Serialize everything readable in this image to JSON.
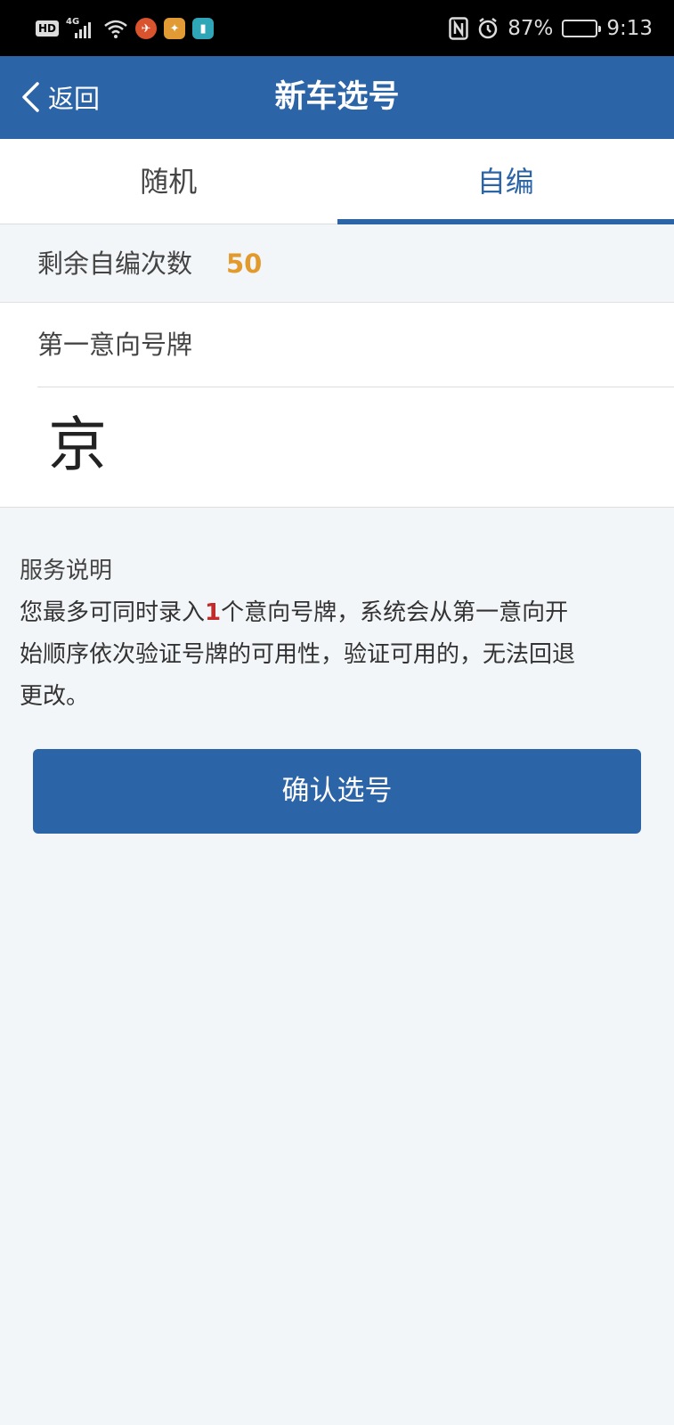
{
  "status_bar": {
    "hd": "HD",
    "network": "4G",
    "battery": "87%",
    "battery_level": 0.87,
    "time": "9:13",
    "icons": [
      "hd-icon",
      "signal-icon",
      "wifi-icon",
      "app-icon",
      "app-icon",
      "app-icon",
      "nfc-icon",
      "alarm-icon",
      "battery-icon"
    ]
  },
  "nav": {
    "back_label": "返回",
    "title": "新车选号"
  },
  "tabs": [
    {
      "label": "随机",
      "active": false
    },
    {
      "label": "自编",
      "active": true
    }
  ],
  "remaining": {
    "label": "剩余自编次数",
    "count": "50"
  },
  "preference": {
    "label": "第一意向号牌",
    "plate_prefix": "京"
  },
  "service": {
    "title": "服务说明",
    "line1_a": "您最多可同时录入",
    "line1_num": "1",
    "line1_b": "个意向号牌，系统会从第一意向开",
    "line2": "始顺序依次验证号牌的可用性，验证可用的，无法回退",
    "line3": "更改。"
  },
  "confirm_button": "确认选号",
  "colors": {
    "primary": "#2c64a8",
    "count": "#e39a2d",
    "highlight": "#c42a2a",
    "background": "#f3f6f8"
  }
}
